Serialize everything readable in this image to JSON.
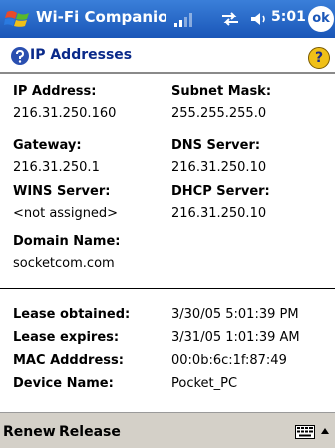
{
  "titlebar": {
    "app_title": "Wi-Fi Companion",
    "time": "5:01",
    "ok_label": "ok",
    "accent": "#1a56b8"
  },
  "header": {
    "page_title": "IP Addresses",
    "help_glyph": "?",
    "help_icon_color": "#f0c018"
  },
  "fields": {
    "ip_address": {
      "label": "IP Address:",
      "value": "216.31.250.160"
    },
    "subnet_mask": {
      "label": "Subnet Mask:",
      "value": "255.255.255.0"
    },
    "gateway": {
      "label": "Gateway:",
      "value": "216.31.250.1"
    },
    "dns_server": {
      "label": "DNS Server:",
      "value": "216.31.250.10"
    },
    "wins_server": {
      "label": "WINS Server:",
      "value": "<not assigned>"
    },
    "dhcp_server": {
      "label": "DHCP Server:",
      "value": "216.31.250.10"
    },
    "domain_name": {
      "label": "Domain Name:",
      "value": "socketcom.com"
    }
  },
  "details": {
    "lease_obtained": {
      "label": "Lease obtained:",
      "value": "3/30/05 5:01:39 PM"
    },
    "lease_expires": {
      "label": "Lease expires:",
      "value": "3/31/05 1:01:39 AM"
    },
    "mac_address": {
      "label": "MAC Adddress:",
      "value": "00:0b:6c:1f:87:49"
    },
    "device_name": {
      "label": "Device Name:",
      "value": "Pocket_PC"
    }
  },
  "menubar": {
    "renew_label": "Renew",
    "release_label": "Release",
    "background": "#d4d0c8"
  }
}
